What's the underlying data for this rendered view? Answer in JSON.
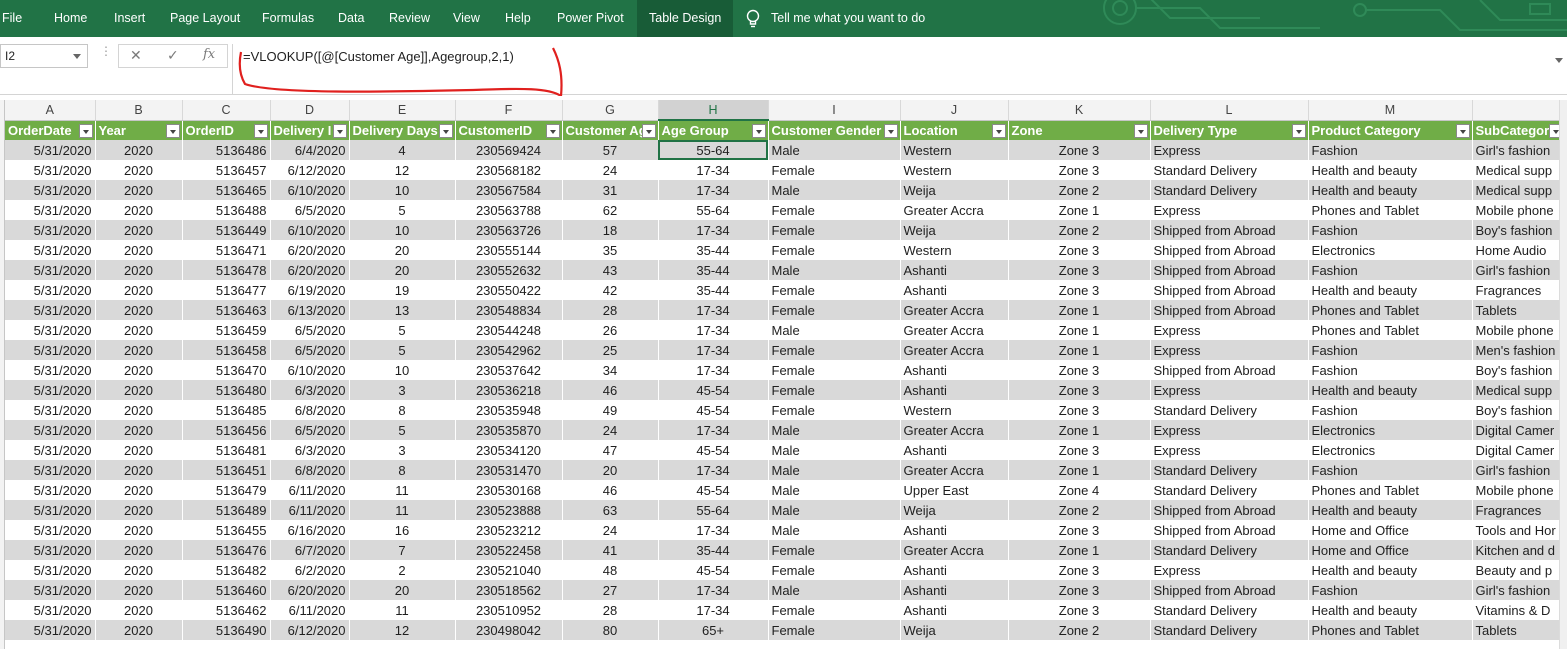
{
  "ribbon": {
    "tabs": [
      "File",
      "Home",
      "Insert",
      "Page Layout",
      "Formulas",
      "Data",
      "Review",
      "View",
      "Help",
      "Power Pivot",
      "Table Design"
    ],
    "active_tab": "Table Design",
    "tell_me": "Tell me what you want to do"
  },
  "formula_bar": {
    "name_box": "I2",
    "cancel_symbol": "✕",
    "enter_symbol": "✓",
    "fx_symbol": "fx",
    "formula": "=VLOOKUP([@[Customer Age]],Agegroup,2,1)"
  },
  "sheet": {
    "column_letters": [
      "A",
      "B",
      "C",
      "D",
      "E",
      "F",
      "G",
      "H",
      "I",
      "J",
      "K",
      "L",
      "M",
      ""
    ],
    "selected_column": "H",
    "headers": [
      "OrderDate",
      "Year",
      "OrderID",
      "Delivery I",
      "Delivery Days",
      "CustomerID",
      "Customer Ag",
      "Age Group",
      "Customer Gender",
      "Location",
      "Zone",
      "Delivery Type",
      "Product Category",
      "SubCategory"
    ],
    "rows": [
      [
        "5/31/2020",
        "2020",
        "5136486",
        "6/4/2020",
        "4",
        "230569424",
        "57",
        "55-64",
        "Male",
        "Western",
        "Zone 3",
        "Express",
        "Fashion",
        "Girl's fashion"
      ],
      [
        "5/31/2020",
        "2020",
        "5136457",
        "6/12/2020",
        "12",
        "230568182",
        "24",
        "17-34",
        "Female",
        "Western",
        "Zone 3",
        "Standard Delivery",
        "Health and beauty",
        "Medical supp"
      ],
      [
        "5/31/2020",
        "2020",
        "5136465",
        "6/10/2020",
        "10",
        "230567584",
        "31",
        "17-34",
        "Male",
        "Weija",
        "Zone 2",
        "Standard Delivery",
        "Health and beauty",
        "Medical supp"
      ],
      [
        "5/31/2020",
        "2020",
        "5136488",
        "6/5/2020",
        "5",
        "230563788",
        "62",
        "55-64",
        "Female",
        "Greater Accra",
        "Zone 1",
        "Express",
        "Phones and Tablet",
        "Mobile phone"
      ],
      [
        "5/31/2020",
        "2020",
        "5136449",
        "6/10/2020",
        "10",
        "230563726",
        "18",
        "17-34",
        "Female",
        "Weija",
        "Zone 2",
        "Shipped from Abroad",
        "Fashion",
        "Boy's fashion"
      ],
      [
        "5/31/2020",
        "2020",
        "5136471",
        "6/20/2020",
        "20",
        "230555144",
        "35",
        "35-44",
        "Female",
        "Western",
        "Zone 3",
        "Shipped from Abroad",
        "Electronics",
        "Home Audio"
      ],
      [
        "5/31/2020",
        "2020",
        "5136478",
        "6/20/2020",
        "20",
        "230552632",
        "43",
        "35-44",
        "Male",
        "Ashanti",
        "Zone 3",
        "Shipped from Abroad",
        "Fashion",
        "Girl's fashion"
      ],
      [
        "5/31/2020",
        "2020",
        "5136477",
        "6/19/2020",
        "19",
        "230550422",
        "42",
        "35-44",
        "Female",
        "Ashanti",
        "Zone 3",
        "Shipped from Abroad",
        "Health and beauty",
        "Fragrances"
      ],
      [
        "5/31/2020",
        "2020",
        "5136463",
        "6/13/2020",
        "13",
        "230548834",
        "28",
        "17-34",
        "Female",
        "Greater Accra",
        "Zone 1",
        "Shipped from Abroad",
        "Phones and Tablet",
        "Tablets"
      ],
      [
        "5/31/2020",
        "2020",
        "5136459",
        "6/5/2020",
        "5",
        "230544248",
        "26",
        "17-34",
        "Male",
        "Greater Accra",
        "Zone 1",
        "Express",
        "Phones and Tablet",
        "Mobile phone"
      ],
      [
        "5/31/2020",
        "2020",
        "5136458",
        "6/5/2020",
        "5",
        "230542962",
        "25",
        "17-34",
        "Female",
        "Greater Accra",
        "Zone 1",
        "Express",
        "Fashion",
        "Men's fashion"
      ],
      [
        "5/31/2020",
        "2020",
        "5136470",
        "6/10/2020",
        "10",
        "230537642",
        "34",
        "17-34",
        "Female",
        "Ashanti",
        "Zone 3",
        "Shipped from Abroad",
        "Fashion",
        "Boy's fashion"
      ],
      [
        "5/31/2020",
        "2020",
        "5136480",
        "6/3/2020",
        "3",
        "230536218",
        "46",
        "45-54",
        "Female",
        "Ashanti",
        "Zone 3",
        "Express",
        "Health and beauty",
        "Medical supp"
      ],
      [
        "5/31/2020",
        "2020",
        "5136485",
        "6/8/2020",
        "8",
        "230535948",
        "49",
        "45-54",
        "Female",
        "Western",
        "Zone 3",
        "Standard Delivery",
        "Fashion",
        "Boy's fashion"
      ],
      [
        "5/31/2020",
        "2020",
        "5136456",
        "6/5/2020",
        "5",
        "230535870",
        "24",
        "17-34",
        "Male",
        "Greater Accra",
        "Zone 1",
        "Express",
        "Electronics",
        "Digital Camer"
      ],
      [
        "5/31/2020",
        "2020",
        "5136481",
        "6/3/2020",
        "3",
        "230534120",
        "47",
        "45-54",
        "Male",
        "Ashanti",
        "Zone 3",
        "Express",
        "Electronics",
        "Digital Camer"
      ],
      [
        "5/31/2020",
        "2020",
        "5136451",
        "6/8/2020",
        "8",
        "230531470",
        "20",
        "17-34",
        "Male",
        "Greater Accra",
        "Zone 1",
        "Standard Delivery",
        "Fashion",
        "Girl's fashion"
      ],
      [
        "5/31/2020",
        "2020",
        "5136479",
        "6/11/2020",
        "11",
        "230530168",
        "46",
        "45-54",
        "Male",
        "Upper East",
        "Zone 4",
        "Standard Delivery",
        "Phones and Tablet",
        "Mobile phone"
      ],
      [
        "5/31/2020",
        "2020",
        "5136489",
        "6/11/2020",
        "11",
        "230523888",
        "63",
        "55-64",
        "Male",
        "Weija",
        "Zone 2",
        "Shipped from Abroad",
        "Health and beauty",
        "Fragrances"
      ],
      [
        "5/31/2020",
        "2020",
        "5136455",
        "6/16/2020",
        "16",
        "230523212",
        "24",
        "17-34",
        "Male",
        "Ashanti",
        "Zone 3",
        "Shipped from Abroad",
        "Home and Office",
        "Tools and Hor"
      ],
      [
        "5/31/2020",
        "2020",
        "5136476",
        "6/7/2020",
        "7",
        "230522458",
        "41",
        "35-44",
        "Female",
        "Greater Accra",
        "Zone 1",
        "Standard Delivery",
        "Home and Office",
        "Kitchen and d"
      ],
      [
        "5/31/2020",
        "2020",
        "5136482",
        "6/2/2020",
        "2",
        "230521040",
        "48",
        "45-54",
        "Female",
        "Ashanti",
        "Zone 3",
        "Express",
        "Health and beauty",
        "Beauty and p"
      ],
      [
        "5/31/2020",
        "2020",
        "5136460",
        "6/20/2020",
        "20",
        "230518562",
        "27",
        "17-34",
        "Male",
        "Ashanti",
        "Zone 3",
        "Shipped from Abroad",
        "Fashion",
        "Girl's fashion"
      ],
      [
        "5/31/2020",
        "2020",
        "5136462",
        "6/11/2020",
        "11",
        "230510952",
        "28",
        "17-34",
        "Female",
        "Ashanti",
        "Zone 3",
        "Standard Delivery",
        "Health and beauty",
        "Vitamins & D"
      ],
      [
        "5/31/2020",
        "2020",
        "5136490",
        "6/12/2020",
        "12",
        "230498042",
        "80",
        "65+",
        "Female",
        "Weija",
        "Zone 2",
        "Standard Delivery",
        "Phones and Tablet",
        "Tablets"
      ]
    ]
  },
  "colors": {
    "ribbon": "#217346",
    "table_header": "#70ad47",
    "annotation": "#e0201e"
  }
}
